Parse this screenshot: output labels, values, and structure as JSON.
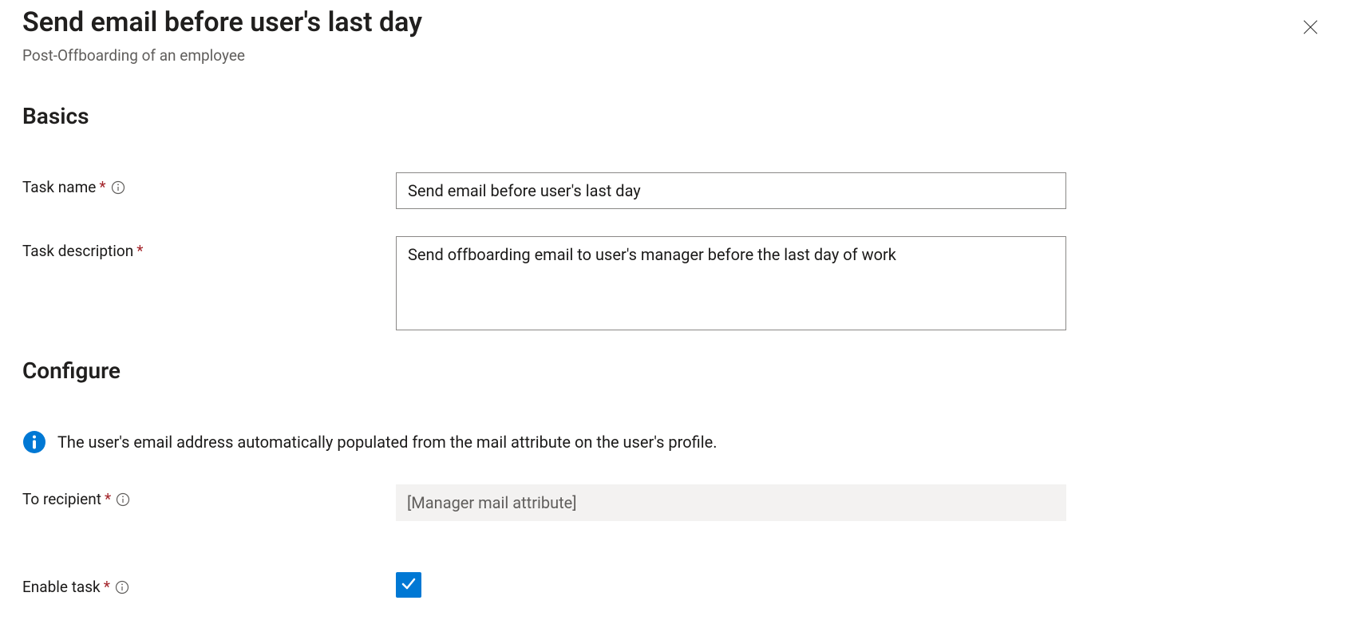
{
  "header": {
    "title": "Send email before user's last day",
    "subtitle": "Post-Offboarding of an employee"
  },
  "sections": {
    "basics_heading": "Basics",
    "configure_heading": "Configure"
  },
  "basics": {
    "task_name_label": "Task name",
    "task_name_value": "Send email before user's last day",
    "task_description_label": "Task description",
    "task_description_value": "Send offboarding email to user's manager before the last day of work"
  },
  "configure": {
    "info_text": "The user's email address automatically populated from the mail attribute on the user's profile.",
    "to_recipient_label": "To recipient",
    "to_recipient_value": "[Manager mail attribute]",
    "enable_task_label": "Enable task",
    "enable_task_checked": true
  },
  "required_marker": "*"
}
